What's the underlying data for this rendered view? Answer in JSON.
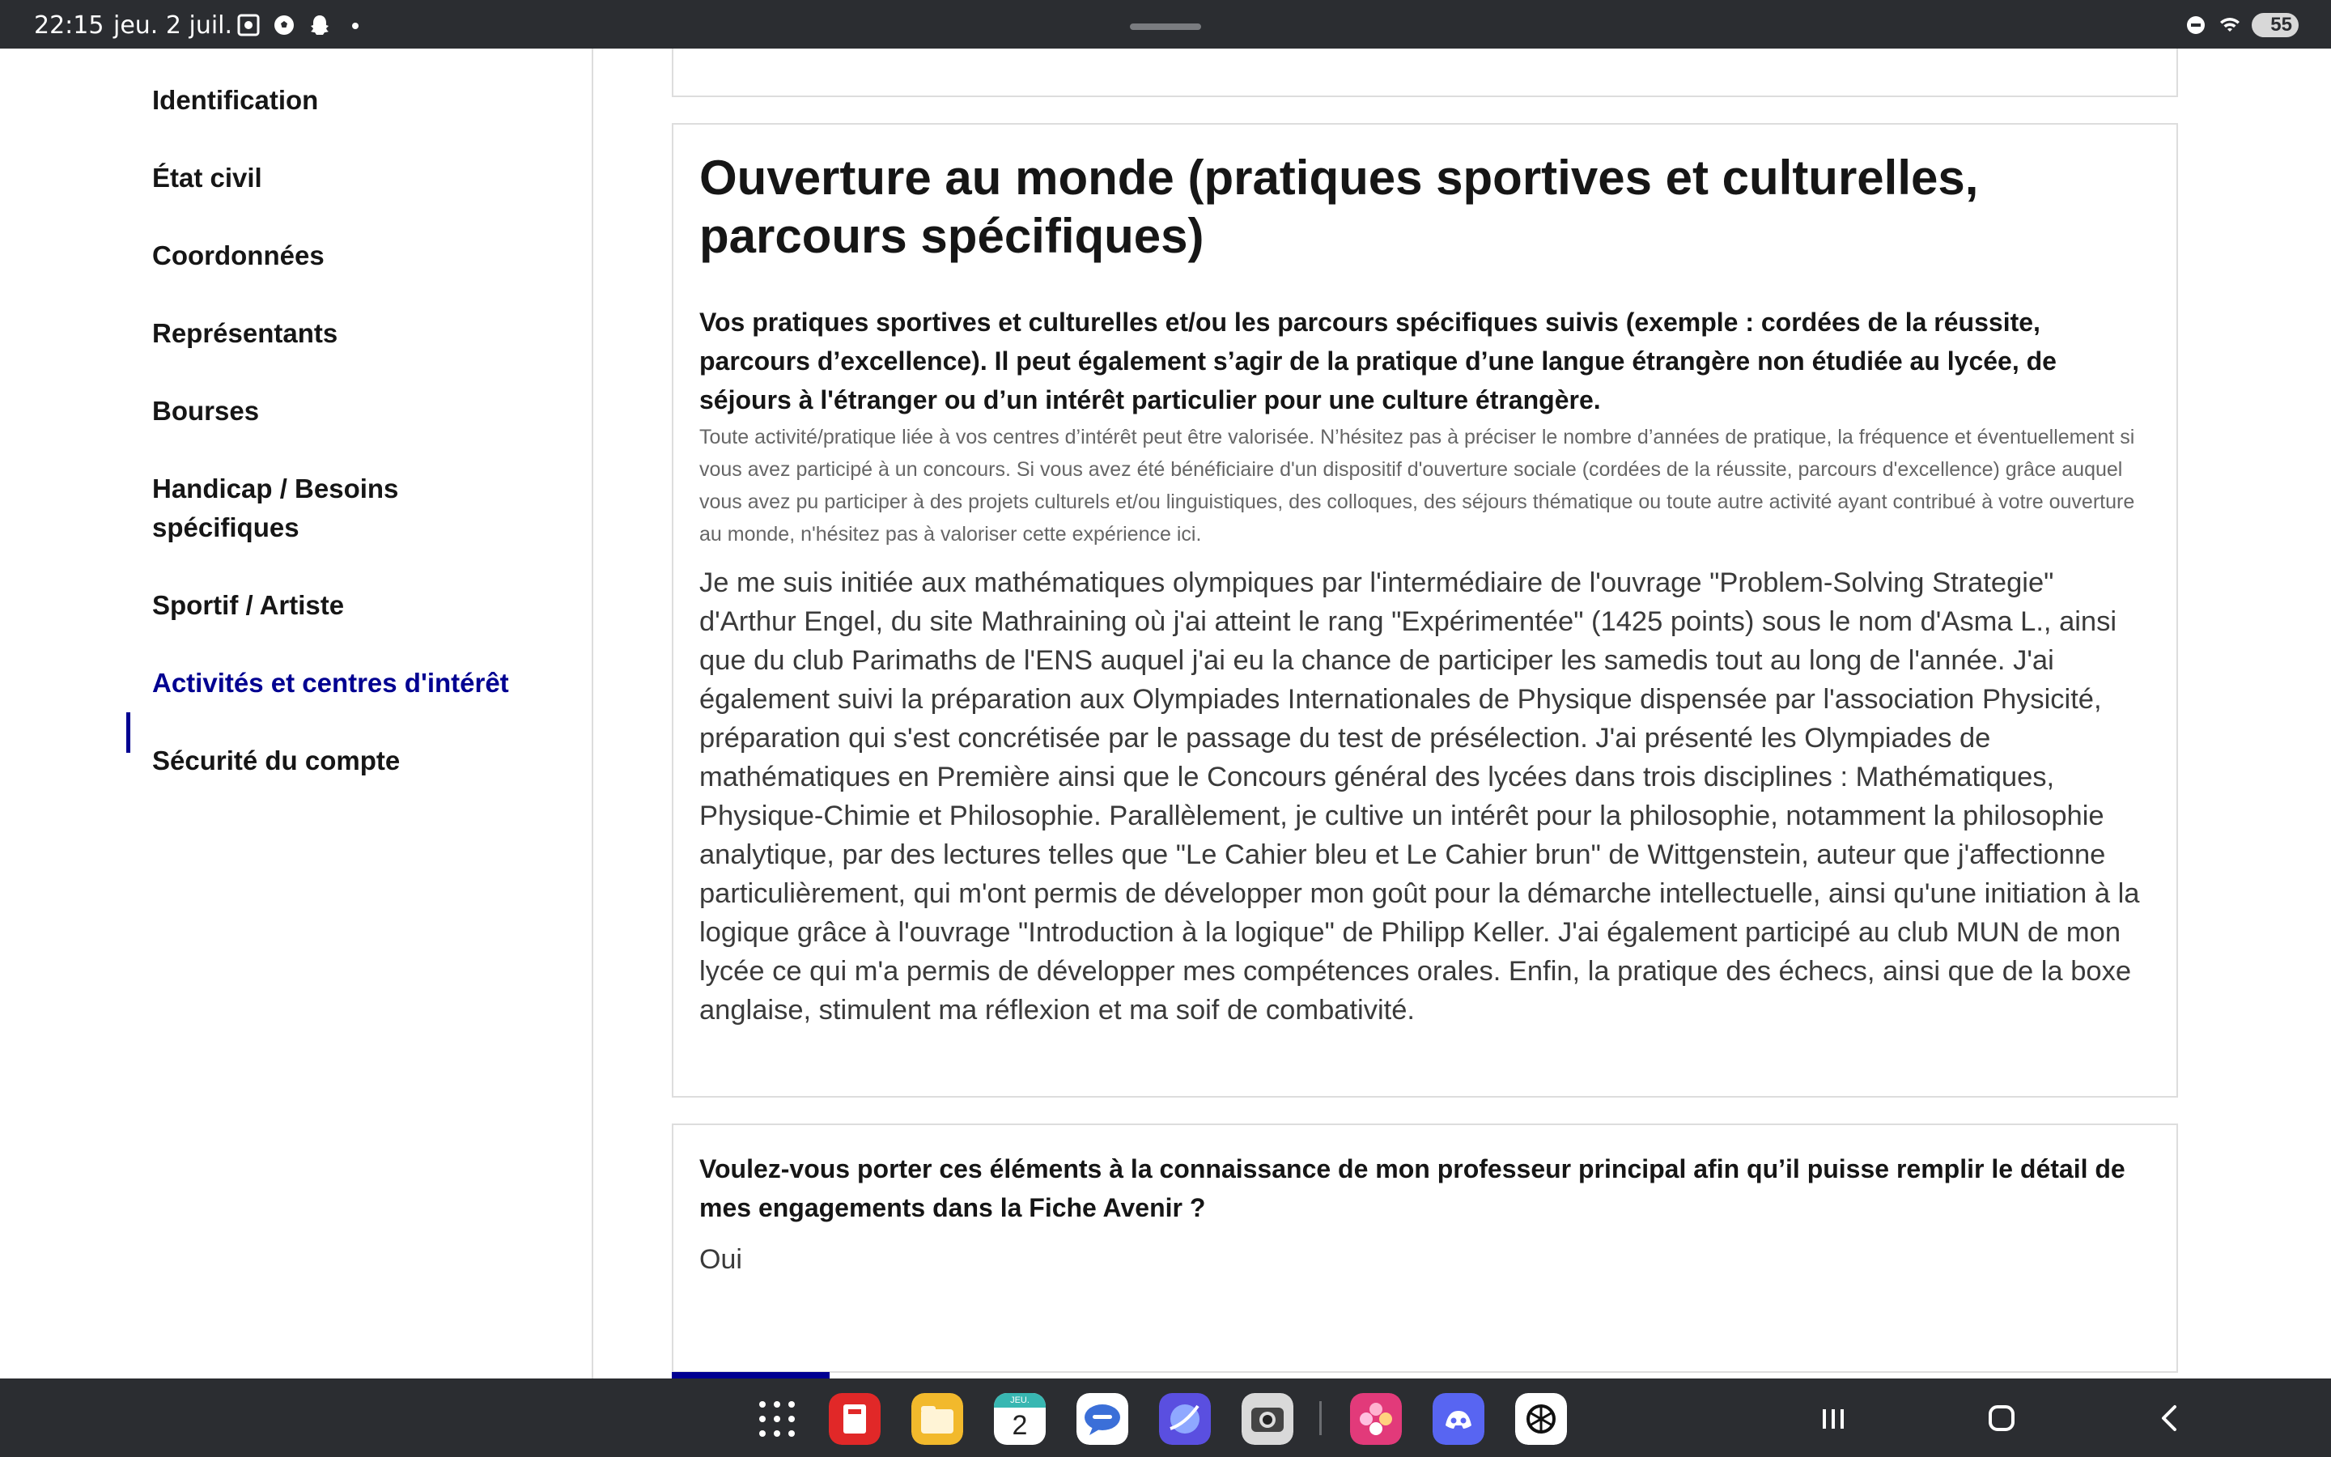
{
  "status_bar": {
    "time": "22:15",
    "date": "jeu. 2 juil.",
    "battery": "55"
  },
  "sidebar": {
    "items": [
      {
        "label": "Identification"
      },
      {
        "label": "État civil"
      },
      {
        "label": "Coordonnées"
      },
      {
        "label": "Représentants"
      },
      {
        "label": "Bourses"
      },
      {
        "label": "Handicap / Besoins spécifiques"
      },
      {
        "label": "Sportif / Artiste"
      },
      {
        "label": "Activités et centres d'intérêt",
        "active": true
      },
      {
        "label": "Sécurité du compte"
      }
    ]
  },
  "section": {
    "title": "Ouverture au monde (pratiques sportives et culturelles, parcours spécifiques)",
    "question": "Vos pratiques sportives et culturelles et/ou les parcours spécifiques suivis (exemple : cordées de la réussite, parcours d’excellence). Il peut également s’agir de la pratique d’une langue étrangère non étudiée au lycée, de séjours à l'étranger ou d’un intérêt particulier pour une culture étrangère.",
    "hint": "Toute activité/pratique liée à vos centres d’intérêt peut être valorisée. N’hésitez pas à préciser le nombre d’années de pratique, la fréquence et éventuellement si vous avez participé à un concours. Si vous avez été bénéficiaire d'un dispositif d'ouverture sociale (cordées de la réussite, parcours d'excellence) grâce auquel vous avez pu participer à des projets culturels et/ou linguistiques, des colloques, des séjours thématique ou toute autre activité ayant contribué à votre ouverture au monde, n'hésitez pas à valoriser cette expérience ici.",
    "answer": "Je me suis initiée aux mathématiques olympiques par l'intermédiaire de l'ouvrage \"Problem-Solving Strategie\" d'Arthur Engel, du site Mathraining où j'ai atteint le rang \"Expérimentée\" (1425 points) sous le nom d'Asma L., ainsi que du club Parimaths de l'ENS auquel j'ai eu la chance de participer les samedis tout au long de l'année. J'ai également suivi la préparation aux Olympiades Internationales de Physique dispensée par l'association Physicité, préparation qui s'est concrétisée par le passage du test de présélection. J'ai présenté les Olympiades de mathématiques en Première ainsi que le Concours général des lycées dans trois disciplines : Mathématiques, Physique-Chimie et Philosophie. Parallèlement, je cultive un intérêt pour la philosophie, notamment la philosophie analytique, par des lectures telles que \"Le Cahier bleu et Le Cahier brun\" de Wittgenstein, auteur que j'affectionne particulièrement, qui m'ont permis de développer mon goût pour la démarche intellectuelle, ainsi qu'une initiation à la logique grâce à l'ouvrage \"Introduction à la logique\" de Philipp Keller. J'ai également participé au club MUN de mon lycée ce qui m'a permis de développer mes compétences orales. Enfin, la pratique des échecs, ainsi que de la boxe anglaise, stimulent ma réflexion et ma soif de combativité."
  },
  "consent": {
    "question": "Voulez-vous porter ces éléments à la connaissance de mon professeur principal afin qu’il puisse remplir le détail de mes engagements dans la Fiche Avenir ?",
    "answer": "Oui"
  },
  "dock": {
    "calendar_day": "2",
    "calendar_month": "JEU.",
    "apps": [
      "app-grid-icon",
      "flipboard-icon",
      "files-icon",
      "calendar-icon",
      "messages-icon",
      "internet-icon",
      "camera-icon",
      "photos-icon",
      "discord-icon",
      "chatgpt-icon"
    ]
  },
  "colors": {
    "accent": "#000091",
    "text": "#161616",
    "border": "#dddddd",
    "system_bar": "#2b2d31"
  }
}
